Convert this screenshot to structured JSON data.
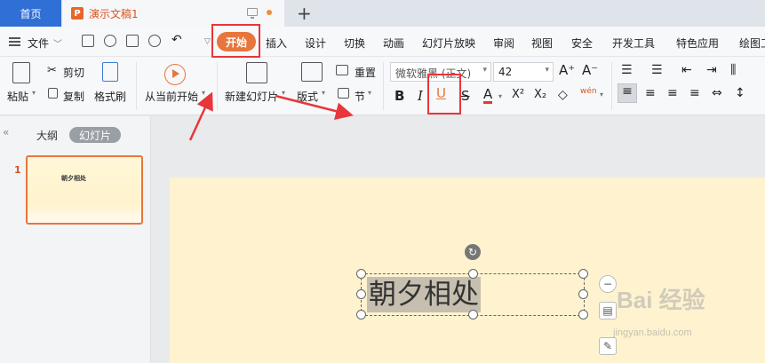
{
  "tabs": {
    "home_label": "首页",
    "doc_logo": "P",
    "doc_name": "演示文稿1",
    "new_tab": "+"
  },
  "menu": {
    "file_label": "文件",
    "start_label": "开始",
    "items": [
      "插入",
      "设计",
      "切换",
      "动画",
      "幻灯片放映",
      "审阅",
      "视图",
      "安全",
      "开发工具",
      "特色应用",
      "绘图工"
    ]
  },
  "ribbon": {
    "paste": "粘贴",
    "cut": "剪切",
    "copy": "复制",
    "format_painter": "格式刷",
    "from_current": "从当前开始",
    "new_slide": "新建幻灯片",
    "layout": "版式",
    "reset": "重置",
    "section": "节",
    "font_name": "微软雅黑 (正文)",
    "font_size": "42",
    "bold": "B",
    "italic": "I",
    "underline": "U",
    "strike": "S",
    "font_color": "A",
    "superscript": "X²",
    "subscript": "X₂",
    "pinyin": "wén"
  },
  "left_pane": {
    "outline_tab": "大纲",
    "slides_tab": "幻灯片",
    "slide_number": "1",
    "thumb_text": "朝夕相处"
  },
  "slide": {
    "text": "朝夕相处"
  },
  "watermark": {
    "main": "Bai 经验",
    "sub": "jingyan.baidu.com"
  },
  "colors": {
    "accent": "#e8763c",
    "annotation": "#e8363a",
    "home_tab": "#2f6fd6",
    "canvas": "#fff3cf"
  }
}
